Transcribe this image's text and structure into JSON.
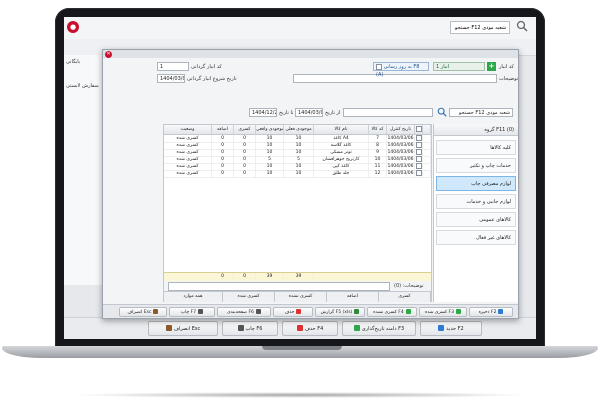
{
  "background": {
    "logo": "●",
    "search_value": "جستجو F12 شعبه مودی",
    "left_label": "بایگانی",
    "left_item": "سفارش لابستی",
    "footer_buttons": [
      {
        "label": "جدید F2",
        "icon": "plus-icon",
        "color": "#2e7bd6"
      },
      {
        "label": "دامنه تاریخ‌گذاری F3",
        "icon": "calendar-icon",
        "color": "#2ca84a"
      },
      {
        "label": "حذف F4",
        "icon": "delete-icon",
        "color": "#d33"
      },
      {
        "label": "چاپ F6",
        "icon": "print-icon",
        "color": "#555"
      },
      {
        "label": "انصراف Esc",
        "icon": "exit-icon",
        "color": "#8a5a2b"
      }
    ]
  },
  "dialog": {
    "title_close": "✕",
    "lbl_serial": "کد انبار گردانی",
    "serial_value": "1",
    "lbl_date": "تاریخ شروع انبار گردانی",
    "date_value": "1404/03/06",
    "stock_chip": "انبار 1",
    "stock_chip_label": "کد انبار",
    "desc_label": "توضیحات",
    "chk_label": "به روز رسانی F8 (A)",
    "filter_date_from": "1404/03/01",
    "filter_date_to": "1404/12/29",
    "filter_from_label": "از تاریخ",
    "filter_to_label": "تا تاریخ",
    "filter_search": "جستجو F12 شعبه مودی",
    "category_header": "گروه F11 (0)",
    "categories": [
      {
        "label": "کلیه کالاها",
        "selected": false
      },
      {
        "label": "خدمات چاپ و تکثیر",
        "selected": false
      },
      {
        "label": "لوازم مصرفی چاپ",
        "selected": true
      },
      {
        "label": "لوازم جانبی و خدمات",
        "selected": false
      },
      {
        "label": "کالاهای عمومی",
        "selected": false
      },
      {
        "label": "کالاهای غیر فعال",
        "selected": false
      }
    ],
    "columns": [
      "",
      "",
      "تاریخ کنترل",
      "کد کالا",
      "نام کالا",
      "موجودی فعلی",
      "موجودی واقعی",
      "کسری",
      "اضافه",
      "وضعیت"
    ],
    "rows": [
      [
        "",
        "",
        "1404/03/06",
        "7",
        "کاغذ A4",
        "10",
        "10",
        "0",
        "0",
        "کسری شده"
      ],
      [
        "",
        "",
        "1404/03/06",
        "8",
        "کاغذ گلاسه",
        "10",
        "10",
        "0",
        "0",
        "کسری شده"
      ],
      [
        "",
        "",
        "1404/03/06",
        "9",
        "تونر مشکی",
        "10",
        "10",
        "0",
        "0",
        "کسری شده"
      ],
      [
        "",
        "",
        "1404/03/06",
        "10",
        "کارتریج جوهرافشان",
        "5",
        "5",
        "0",
        "0",
        "کسری شده"
      ],
      [
        "",
        "",
        "1404/03/06",
        "11",
        "کاغذ کپی",
        "10",
        "10",
        "0",
        "0",
        "کسری شده"
      ],
      [
        "",
        "",
        "1404/03/06",
        "12",
        "جلد طلق",
        "10",
        "10",
        "0",
        "0",
        "کسری شده"
      ]
    ],
    "totals": [
      "",
      "",
      "",
      "",
      "",
      "39",
      "39",
      "0",
      "0",
      ""
    ],
    "desc_footer_label": "توضیحات: (0)",
    "status_tabs": [
      "کسری",
      "اضافه",
      "کسری نشده",
      "کسری شده",
      "همه موارد"
    ],
    "buttons": [
      {
        "label": "ذخیره F2",
        "icon": "save-icon",
        "color": "#2e7bd6"
      },
      {
        "label": "کسری شده F3",
        "icon": "check-icon",
        "color": "#2ca84a"
      },
      {
        "label": "کسری نشده F4",
        "icon": "check-icon",
        "color": "#2ca84a"
      },
      {
        "label": "گزارش F5 (xls)",
        "icon": "excel-icon",
        "color": "#2e8b3a"
      },
      {
        "label": "حذف",
        "icon": "delete-icon",
        "color": "#d33"
      },
      {
        "label": "صفحه‌بندی F6",
        "icon": "print-icon",
        "color": "#555"
      },
      {
        "label": "چاپ F7",
        "icon": "print-icon",
        "color": "#555"
      },
      {
        "label": "انصراف Esc",
        "icon": "exit-icon",
        "color": "#8a5a2b"
      }
    ]
  }
}
